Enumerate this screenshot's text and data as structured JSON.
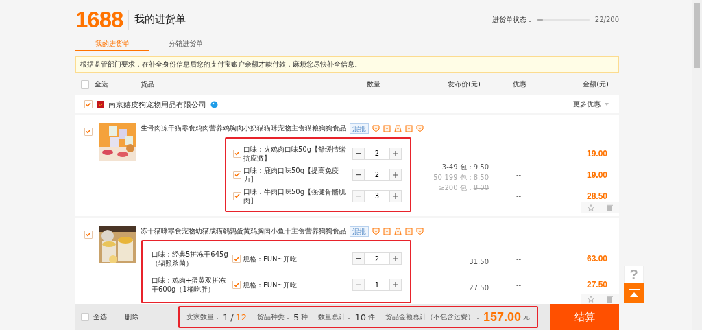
{
  "header": {
    "logo": "1688",
    "title": "我的进货单",
    "status_label": "进货单状态：",
    "status": {
      "level": 0.11
    },
    "status_count": "22/200"
  },
  "tabs": [
    {
      "label": "我的进货单",
      "selected": true
    },
    {
      "label": "分销进货单",
      "selected": false
    }
  ],
  "notice": "根据监管部门要求，在补全身份信息后您的支付宝账户余额才能付款，麻烦您尽快补全信息。",
  "columns": {
    "select_all": {
      "label": "全选",
      "checked": false
    },
    "goods": "货品",
    "quantity": "数量",
    "price": "发布价(元)",
    "discount": "优惠",
    "amount": "金额(元)"
  },
  "shop": {
    "name": "南京嬉皮狗宠物用品有限公司",
    "checked": true,
    "more_offers": "更多优惠"
  },
  "items": [
    {
      "kind": "tiered",
      "checked": true,
      "title": "生骨肉冻干猫零食鸡肉营养鸡胸肉小奶猫猫咪宠物主食猫粮狗狗食品",
      "tag": "混批",
      "highlighted": true,
      "price_tiers": [
        {
          "range": "3-49 包：",
          "price": "9.50",
          "active": true
        },
        {
          "range": "50-199 包：",
          "price": "8.50",
          "active": false
        },
        {
          "range": "≥200 包：",
          "price": "8.00",
          "active": false
        }
      ],
      "variants": [
        {
          "flavor": "口味：火鸡肉口味50g【舒缓情绪抗应激】",
          "checked": true,
          "quantity": "2",
          "minus_disabled": false,
          "discount": "--",
          "amount": "19.00"
        },
        {
          "flavor": "口味：鹿肉口味50g【提高免疫力】",
          "checked": true,
          "quantity": "2",
          "minus_disabled": false,
          "discount": "--",
          "amount": "19.00"
        },
        {
          "flavor": "口味：牛肉口味50g【强健骨骼肌肉】",
          "checked": true,
          "quantity": "3",
          "minus_disabled": false,
          "discount": "--",
          "amount": "28.50"
        }
      ]
    },
    {
      "kind": "spec",
      "checked": true,
      "title": "冻干猫咪零食宠物幼猫成猫鹌鹑蛋黄鸡胸肉小鱼干主食营养狗狗食品",
      "tag": "混批",
      "highlighted": true,
      "variants": [
        {
          "flavor": "口味：经典5拼冻干645g（辐照杀菌）",
          "checked": true,
          "spec": "规格：FUN~开吃",
          "quantity": "2",
          "minus_disabled": false,
          "price": "31.50",
          "discount": "--",
          "amount": "63.00"
        },
        {
          "flavor": "口味：鸡肉+蛋黄双拼冻干600g（1桶吃胖）",
          "checked": true,
          "spec": "规格：FUN~开吃",
          "quantity": "1",
          "minus_disabled": true,
          "price": "27.50",
          "discount": "--",
          "amount": "27.50"
        }
      ]
    }
  ],
  "footer": {
    "select_all": {
      "label": "全选",
      "checked": false
    },
    "delete": "删除",
    "highlighted": true,
    "seller_label": "卖家数量：",
    "seller_selected": "1",
    "seller_sep": "/",
    "seller_total": "12",
    "kinds_label": "货品种类：",
    "kinds": "5",
    "kinds_unit": "种",
    "qty_label": "数量总计：",
    "qty": "10",
    "qty_unit": "件",
    "total_label": "货品金额总计（不包含运费）：",
    "total": "157.00",
    "total_unit": "元",
    "checkout": "结算"
  },
  "side_tools": {
    "help": "?"
  }
}
